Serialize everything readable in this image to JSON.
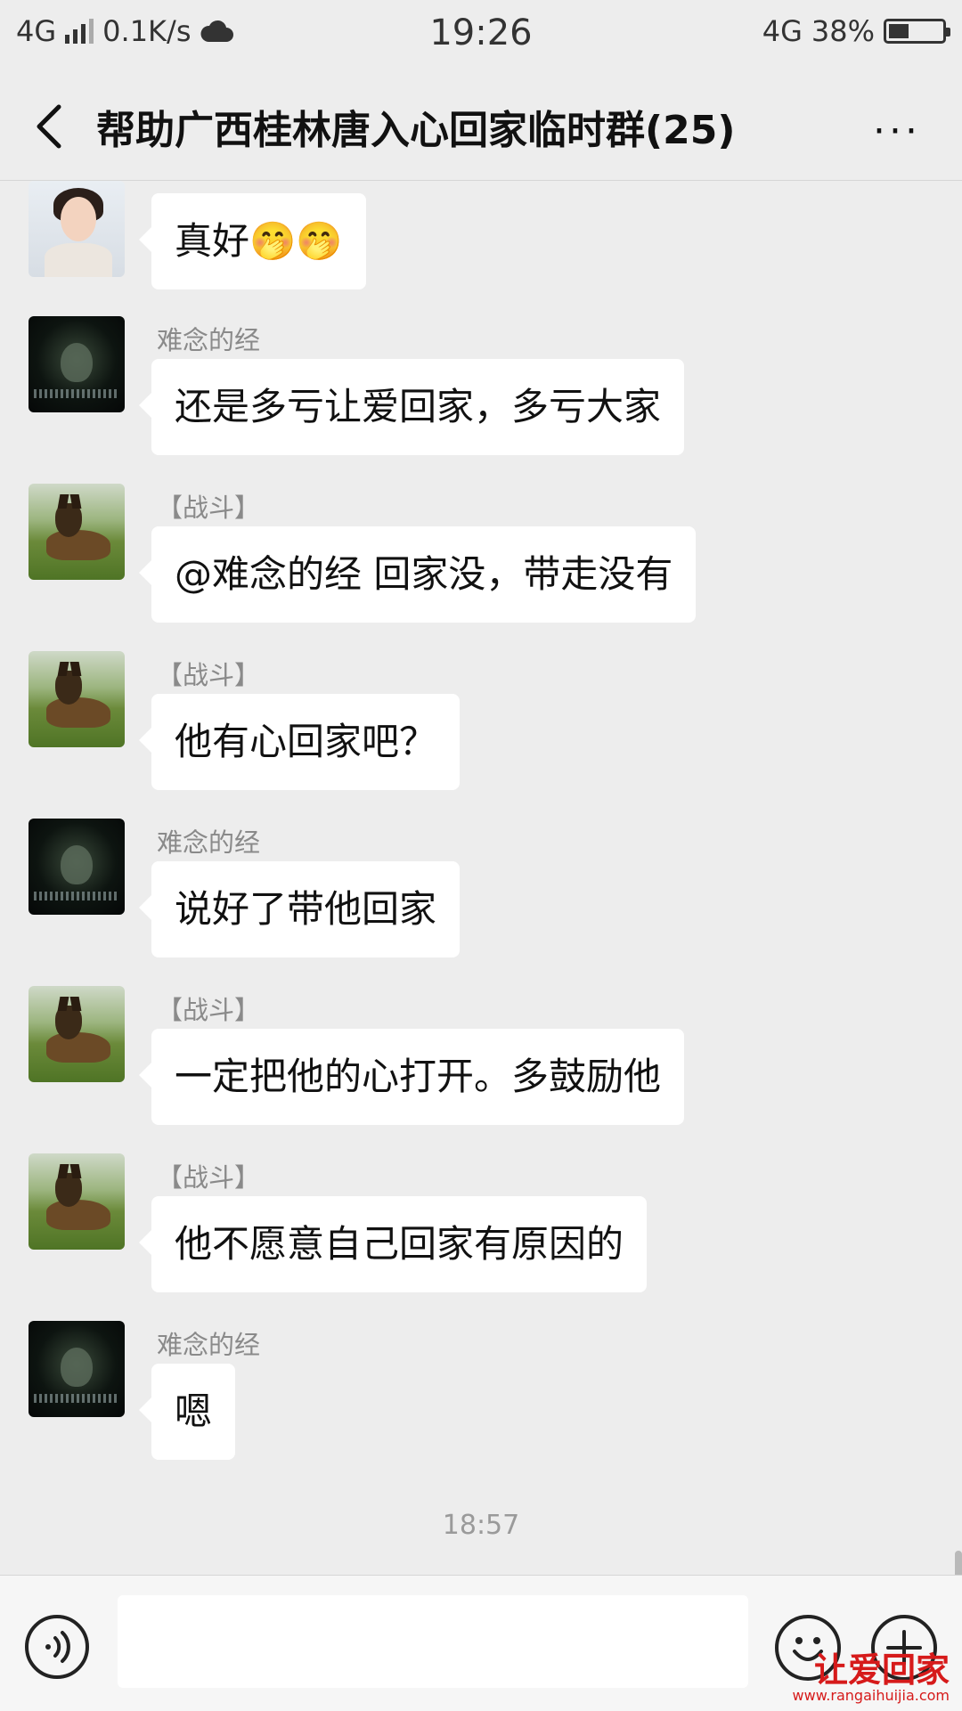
{
  "status_bar": {
    "network_left": "4G",
    "speed": "0.1K/s",
    "time": "19:26",
    "network_right": "4G",
    "battery": "38%",
    "battery_level": 0.38
  },
  "header": {
    "title": "帮助广西桂林唐入心回家临时群(25)",
    "more": "···"
  },
  "messages": [
    {
      "sender": "",
      "text": "真好🤭🤭",
      "avatar": "girl-avatar"
    },
    {
      "sender": "难念的经",
      "text": "还是多亏让爱回家，多亏大家",
      "avatar": "dark-mask-avatar"
    },
    {
      "sender": "【战斗】",
      "text": "@难念的经  回家没，带走没有",
      "avatar": "dog-avatar"
    },
    {
      "sender": "【战斗】",
      "text": "他有心回家吧？",
      "avatar": "dog-avatar"
    },
    {
      "sender": "难念的经",
      "text": "说好了带他回家",
      "avatar": "dark-mask-avatar"
    },
    {
      "sender": "【战斗】",
      "text": "一定把他的心打开。多鼓励他",
      "avatar": "dog-avatar"
    },
    {
      "sender": "【战斗】",
      "text": "他不愿意自己回家有原因的",
      "avatar": "dog-avatar"
    },
    {
      "sender": "难念的经",
      "text": "嗯",
      "avatar": "dark-mask-avatar"
    }
  ],
  "timestamp": "18:57",
  "input": {
    "value": "",
    "placeholder": ""
  },
  "watermark": {
    "brand": "让爱回家",
    "url": "www.rangaihuijia.com"
  }
}
